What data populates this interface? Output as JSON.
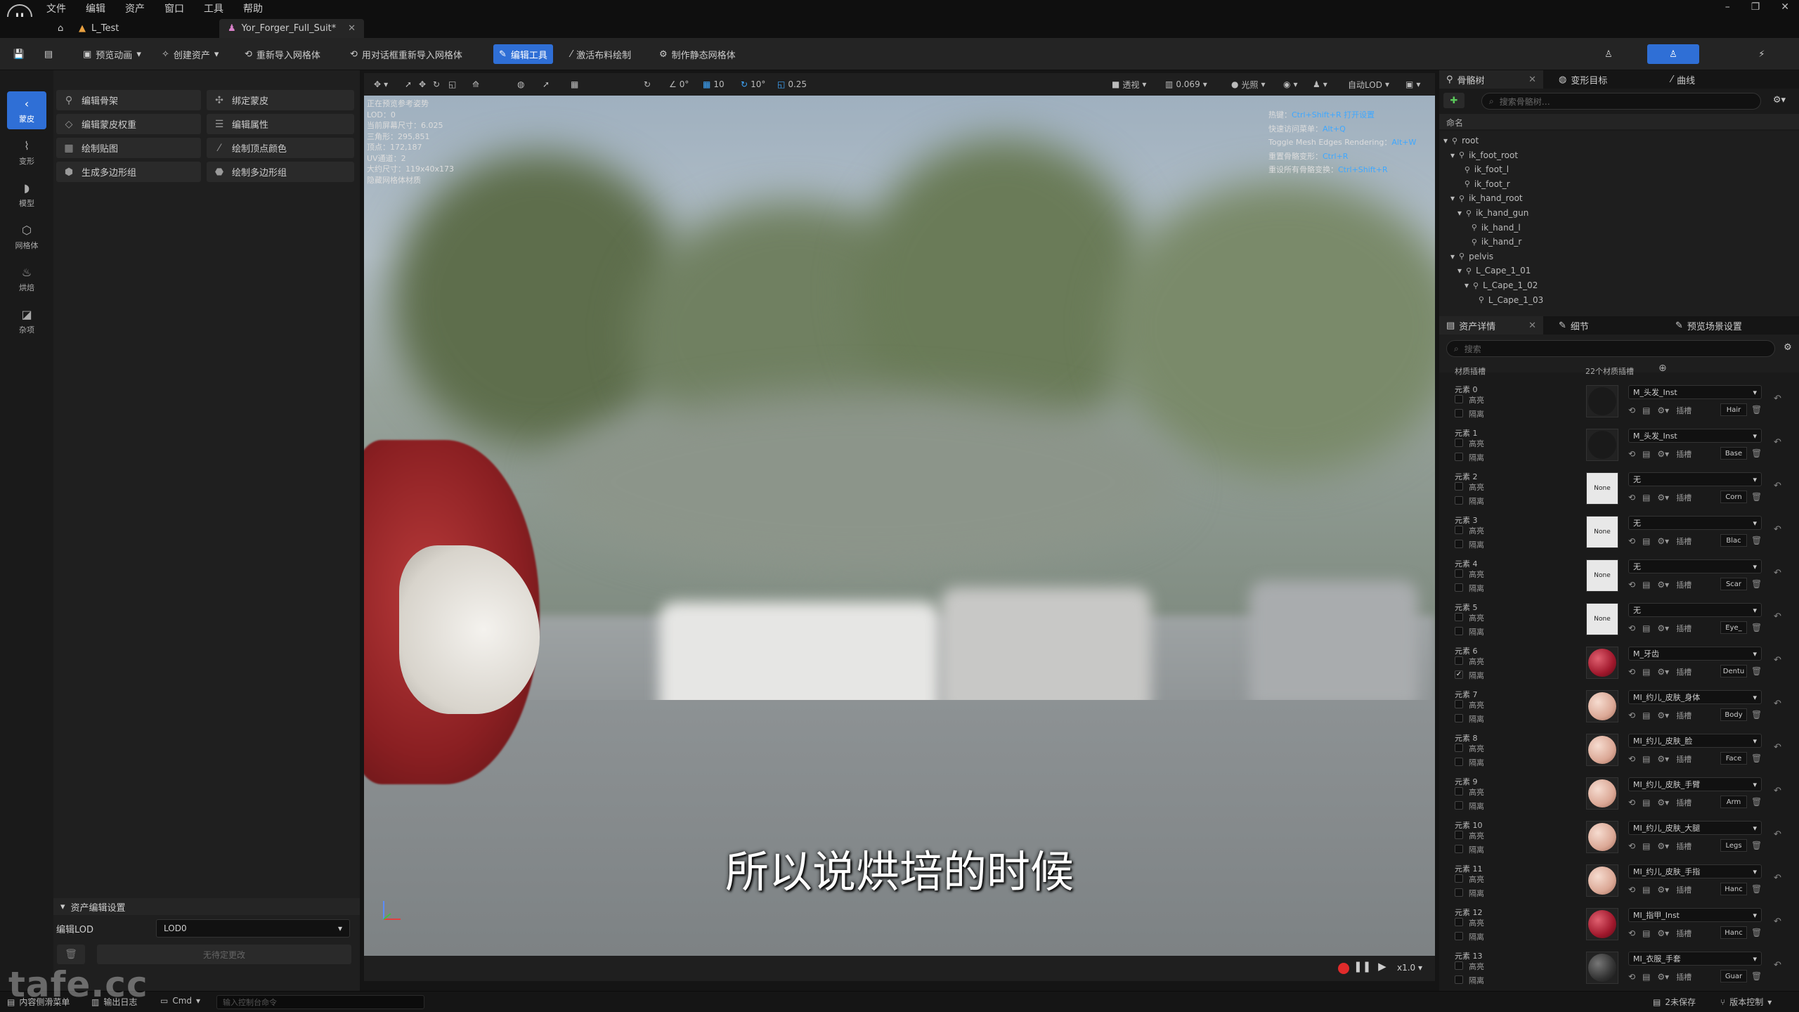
{
  "menu": [
    "文件",
    "编辑",
    "资产",
    "窗口",
    "工具",
    "帮助"
  ],
  "tabs": {
    "level": "L_Test",
    "asset": "Yor_Forger_Full_Suit*"
  },
  "toolbar": {
    "preview_anim": "预览动画",
    "create_asset": "创建资产",
    "reimport_mesh": "重新导入网格体",
    "reimport_dialog": "用对话框重新导入网格体",
    "edit_tools": "编辑工具",
    "activate_cloth": "激活布料绘制",
    "make_static": "制作静态网格体"
  },
  "rail": [
    "蒙皮",
    "变形",
    "模型",
    "网格体",
    "烘焙",
    "杂项"
  ],
  "left_tools": [
    [
      "编辑骨架",
      "绑定蒙皮"
    ],
    [
      "编辑蒙皮权重",
      "编辑属性"
    ],
    [
      "绘制贴图",
      "绘制顶点颜色"
    ],
    [
      "生成多边形组",
      "绘制多边形组"
    ]
  ],
  "asset_edit": {
    "section": "资产编辑设置",
    "lod_label": "编辑LOD",
    "lod_value": "LOD0",
    "no_change": "无待定更改"
  },
  "viewport": {
    "toolbar": {
      "angle": "0°",
      "grid": "10",
      "rot": "10°",
      "scale": "0.25",
      "perspective": "透视",
      "fov": "0.069",
      "lit": "光照",
      "lod": "自动LOD"
    },
    "stats": [
      "正在预览参考姿势",
      "LOD：0",
      "当前屏幕尺寸：6.025",
      "三角形：295,851",
      "顶点：172,187",
      "UV通道：2",
      "大约尺寸：119x40x173",
      "隐藏网格体材质"
    ],
    "hotkeys": [
      {
        "k": "热键：",
        "v": "Ctrl+Shift+R  打开设置"
      },
      {
        "k": "快速访问菜单：",
        "v": "Alt+Q"
      },
      {
        "k": "Toggle Mesh Edges Rendering：",
        "v": "Alt+W"
      },
      {
        "k": "重置骨骼变形：",
        "v": "Ctrl+R"
      },
      {
        "k": "重设所有骨骼变换：",
        "v": "Ctrl+Shift+R"
      }
    ],
    "subtitle": "所以说烘培的时候",
    "speed": "x1.0"
  },
  "skeleton_panel": {
    "tabs": [
      "骨骼树",
      "变形目标",
      "曲线"
    ],
    "search_placeholder": "搜索骨骼树…",
    "header": "命名",
    "bones": [
      {
        "name": "root",
        "depth": 0
      },
      {
        "name": "ik_foot_root",
        "depth": 1
      },
      {
        "name": "ik_foot_l",
        "depth": 2
      },
      {
        "name": "ik_foot_r",
        "depth": 2
      },
      {
        "name": "ik_hand_root",
        "depth": 1
      },
      {
        "name": "ik_hand_gun",
        "depth": 2
      },
      {
        "name": "ik_hand_l",
        "depth": 3
      },
      {
        "name": "ik_hand_r",
        "depth": 3
      },
      {
        "name": "pelvis",
        "depth": 1
      },
      {
        "name": "L_Cape_1_01",
        "depth": 2
      },
      {
        "name": "L_Cape_1_02",
        "depth": 3
      },
      {
        "name": "L_Cape_1_03",
        "depth": 4
      }
    ]
  },
  "details_panel": {
    "tabs": [
      "资产详情",
      "细节",
      "预览场景设置"
    ],
    "search_placeholder": "搜索",
    "section": "材质插槽",
    "count": "22个材质插槽",
    "opt_highlight": "高亮",
    "opt_isolate": "隔离",
    "slot_label": "插槽",
    "slots": [
      {
        "el": "元素 0",
        "mat": "M_头发_Inst",
        "name": "Hair",
        "thumb": "dark"
      },
      {
        "el": "元素 1",
        "mat": "M_头发_Inst",
        "name": "Base",
        "thumb": "dark"
      },
      {
        "el": "元素 2",
        "mat": "无",
        "name": "Corn",
        "thumb": "none"
      },
      {
        "el": "元素 3",
        "mat": "无",
        "name": "Blac",
        "thumb": "none"
      },
      {
        "el": "元素 4",
        "mat": "无",
        "name": "Scar",
        "thumb": "none"
      },
      {
        "el": "元素 5",
        "mat": "无",
        "name": "Eye_",
        "thumb": "none"
      },
      {
        "el": "元素 6",
        "mat": "M_牙齿",
        "name": "Dentu",
        "thumb": "red",
        "isolate": true
      },
      {
        "el": "元素 7",
        "mat": "MI_约儿_皮肤_身体",
        "name": "Body",
        "thumb": "skin"
      },
      {
        "el": "元素 8",
        "mat": "MI_约儿_皮肤_脸",
        "name": "Face",
        "thumb": "skin"
      },
      {
        "el": "元素 9",
        "mat": "MI_约儿_皮肤_手臂",
        "name": "Arm",
        "thumb": "skin"
      },
      {
        "el": "元素 10",
        "mat": "MI_约儿_皮肤_大腿",
        "name": "Legs",
        "thumb": "skin"
      },
      {
        "el": "元素 11",
        "mat": "MI_约儿_皮肤_手指",
        "name": "Hanc",
        "thumb": "skin"
      },
      {
        "el": "元素 12",
        "mat": "MI_指甲_Inst",
        "name": "Hanc",
        "thumb": "red"
      },
      {
        "el": "元素 13",
        "mat": "MI_衣服_手套",
        "name": "Guar",
        "thumb": "darkglove"
      }
    ]
  },
  "status": {
    "drawer": "内容侧滑菜单",
    "log": "输出日志",
    "cmd": "Cmd",
    "cmd_placeholder": "输入控制台命令",
    "unsaved": "2未保存",
    "vcs": "版本控制"
  },
  "watermark": "tafe.cc"
}
